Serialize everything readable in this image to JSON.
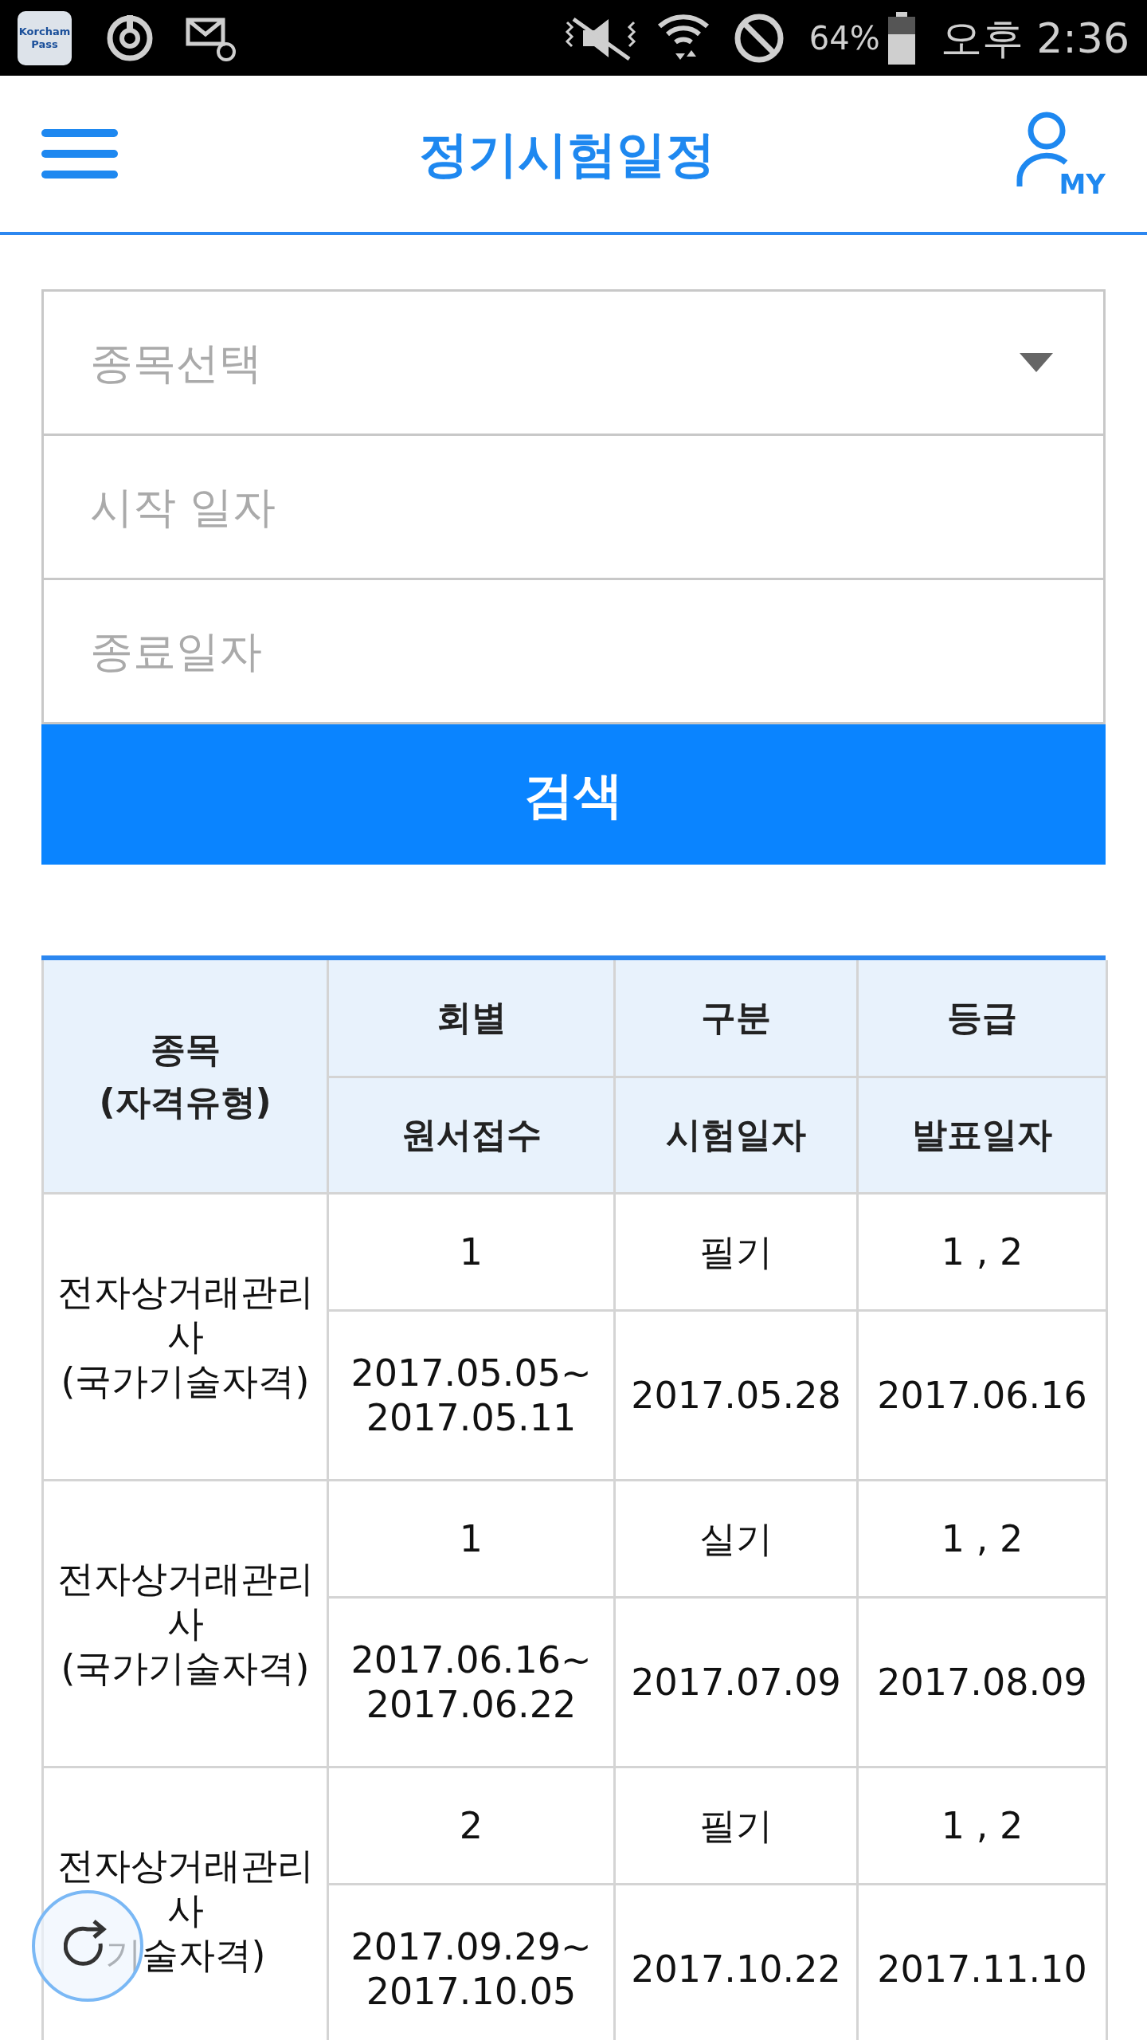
{
  "status_bar": {
    "app_icon_text": "Korcham Pass",
    "battery": "64%",
    "time": "오후 2:36"
  },
  "header": {
    "title": "정기시험일정",
    "my_label": "MY"
  },
  "form": {
    "fields": [
      {
        "kind": "select",
        "placeholder": "종목선택"
      },
      {
        "kind": "input",
        "placeholder": "시작 일자"
      },
      {
        "kind": "input",
        "placeholder": "종료일자"
      }
    ],
    "search_button": "검색"
  },
  "table": {
    "header": {
      "name": "종목",
      "name_sub": "(자격유형)",
      "round": "회별",
      "type": "구분",
      "grade": "등급",
      "application": "원서접수",
      "exam_date": "시험일자",
      "announce_date": "발표일자"
    },
    "rows": [
      {
        "name": "전자상거래관리사",
        "qualification": "(국가기술자격)",
        "round": "1",
        "type": "필기",
        "grade": "1 , 2",
        "application_start": "2017.05.05~",
        "application_end": "2017.05.11",
        "exam_date": "2017.05.28",
        "announce_date": "2017.06.16"
      },
      {
        "name": "전자상거래관리사",
        "qualification": "(국가기술자격)",
        "round": "1",
        "type": "실기",
        "grade": "1 , 2",
        "application_start": "2017.06.16~",
        "application_end": "2017.06.22",
        "exam_date": "2017.07.09",
        "announce_date": "2017.08.09"
      },
      {
        "name": "전자상거래관리사",
        "qualification": "기술자격)",
        "round": "2",
        "type": "필기",
        "grade": "1 , 2",
        "application_start": "2017.09.29~",
        "application_end": "2017.10.05",
        "exam_date": "2017.10.22",
        "announce_date": "2017.11.10"
      }
    ]
  }
}
